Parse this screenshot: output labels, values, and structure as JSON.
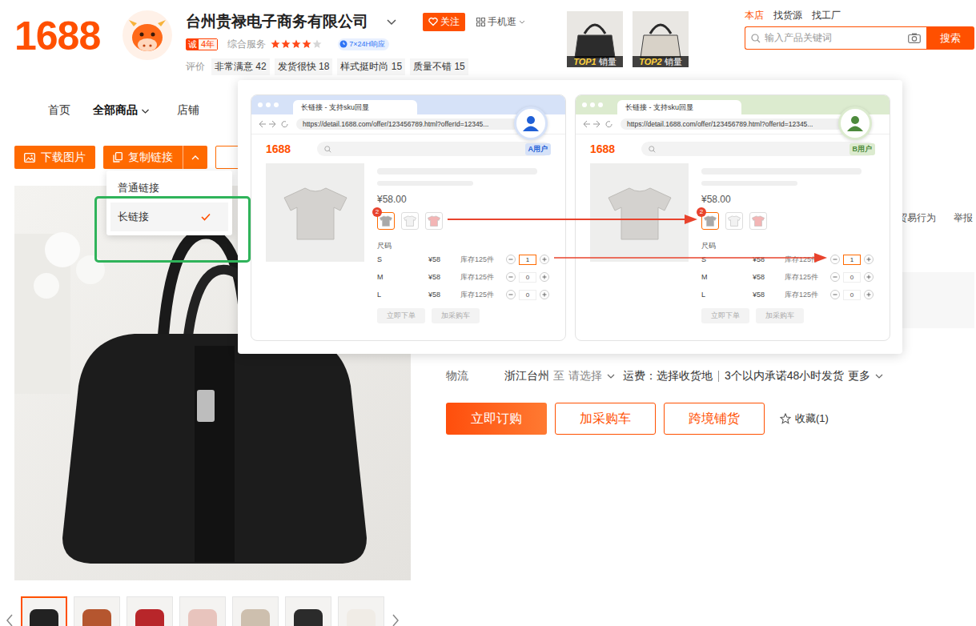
{
  "header": {
    "logo": "1688",
    "shop_name": "台州贵禄电子商务有限公司",
    "follow": "关注",
    "mobile": "手机逛",
    "credit": {
      "mark": "诚",
      "years": "4年"
    },
    "service_label": "综合服务",
    "stars": 4,
    "response": "7×24H响应",
    "reviews_label": "评价",
    "reviews": [
      {
        "label": "非常满意",
        "count": "42"
      },
      {
        "label": "发货很快",
        "count": "18"
      },
      {
        "label": "样式挺时尚",
        "count": "15"
      },
      {
        "label": "质量不错",
        "count": "15"
      }
    ]
  },
  "top_products": [
    {
      "rank": "TOP1",
      "label": "销量"
    },
    {
      "rank": "TOP2",
      "label": "销量"
    }
  ],
  "search": {
    "tabs": [
      {
        "label": "本店",
        "selected": true
      },
      {
        "label": "找货源",
        "selected": false
      },
      {
        "label": "找工厂",
        "selected": false
      }
    ],
    "placeholder": "输入产品关键词",
    "button": "搜索"
  },
  "nav": [
    {
      "label": "首页",
      "selected": false,
      "has_menu": false
    },
    {
      "label": "全部商品",
      "selected": true,
      "has_menu": true
    },
    {
      "label": "店铺",
      "selected": false,
      "has_menu": false
    }
  ],
  "toolbar": {
    "download": "下载图片",
    "copy": "复制链接",
    "copy_menu_open": true,
    "menu": [
      {
        "label": "普通链接",
        "selected": false,
        "highlighted": false
      },
      {
        "label": "长链接",
        "selected": true,
        "highlighted": true
      }
    ]
  },
  "demo": {
    "windows": [
      {
        "tab_title": "长链接 - 支持sku回显",
        "url": "https://detail.1688.com/offer/123456789.html?offerId=12345...",
        "user": "A用户",
        "color": "#1f5fd6",
        "bar_color": "#d6e2f8",
        "logo": "1688",
        "price": "¥58.00",
        "swatch_badge": "2",
        "swatches": [
          {
            "color": "#a9a9a9",
            "selected": true
          },
          {
            "color": "#f2f2f2",
            "selected": false
          },
          {
            "color": "#f3b5b5",
            "selected": false
          }
        ],
        "size_label": "尺码",
        "sizes": [
          {
            "size": "S",
            "price": "¥58",
            "stock": "库存125件",
            "qty": "1",
            "selected": true
          },
          {
            "size": "M",
            "price": "¥58",
            "stock": "库存125件",
            "qty": "0",
            "selected": false
          },
          {
            "size": "L",
            "price": "¥58",
            "stock": "库存125件",
            "qty": "0",
            "selected": false
          }
        ],
        "buttons": [
          "立即下单",
          "加采购车"
        ]
      },
      {
        "tab_title": "长链接 - 支持sku回显",
        "url": "https://detail.1688.com/offer/123456789.html?offerId=12345...",
        "user": "B用户",
        "color": "#4d8a3c",
        "bar_color": "#dcebcf",
        "logo": "1688",
        "price": "¥58.00",
        "swatch_badge": "2",
        "swatches": [
          {
            "color": "#a9a9a9",
            "selected": true
          },
          {
            "color": "#f2f2f2",
            "selected": false
          },
          {
            "color": "#f3b5b5",
            "selected": false
          }
        ],
        "size_label": "尺码",
        "sizes": [
          {
            "size": "S",
            "price": "¥58",
            "stock": "库存125件",
            "qty": "1",
            "selected": true
          },
          {
            "size": "M",
            "price": "¥58",
            "stock": "库存125件",
            "qty": "0",
            "selected": false
          },
          {
            "size": "L",
            "price": "¥58",
            "stock": "库存125件",
            "qty": "0",
            "selected": false
          }
        ],
        "buttons": [
          "立即下单",
          "加采购车"
        ]
      }
    ]
  },
  "gallery": {
    "thumbs": [
      {
        "color": "#222222",
        "selected": true
      },
      {
        "color": "#b5562f",
        "selected": false
      },
      {
        "color": "#b8262a",
        "selected": false
      },
      {
        "color": "#e8c4bd",
        "selected": false
      },
      {
        "color": "#cdbfae",
        "selected": false
      },
      {
        "color": "#2b2b2b",
        "selected": false
      },
      {
        "color": "#f0ece6",
        "selected": false
      }
    ]
  },
  "side_links": [
    "贸易行为",
    "举报"
  ],
  "logistics": {
    "label": "物流",
    "origin": "浙江台州",
    "to": "至",
    "destination": "请选择",
    "fee": "运费：选择收货地",
    "promise": "3个以内承诺48小时发货",
    "more": "更多"
  },
  "actions": [
    {
      "label": "立即订购",
      "kind": "primary"
    },
    {
      "label": "加采购车",
      "kind": "outline"
    },
    {
      "label": "跨境铺货",
      "kind": "outline"
    }
  ],
  "favorite": {
    "label": "收藏(1)",
    "selected": false
  }
}
